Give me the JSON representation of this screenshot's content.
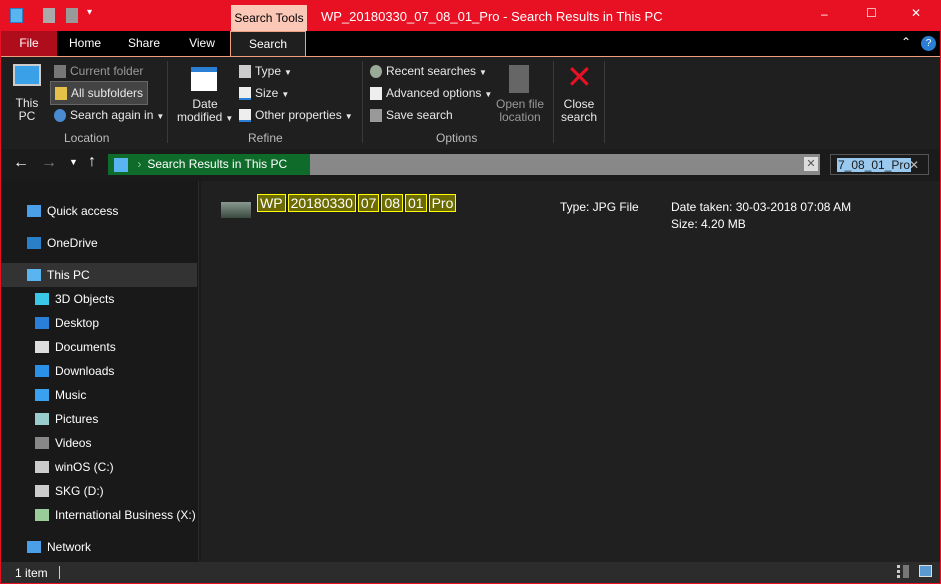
{
  "titlebar": {
    "context_tab": "Search Tools",
    "title": "WP_20180330_07_08_01_Pro - Search Results in This PC",
    "minimize": "–",
    "maximize": "☐",
    "close": "✕"
  },
  "tabs": [
    {
      "label": "File"
    },
    {
      "label": "Home"
    },
    {
      "label": "Share"
    },
    {
      "label": "View"
    },
    {
      "label": "Search"
    }
  ],
  "ribbon": {
    "location": {
      "label": "Location",
      "this_pc": "This PC",
      "current_folder": "Current folder",
      "all_subfolders": "All subfolders",
      "search_again": "Search again in"
    },
    "refine": {
      "label": "Refine",
      "date_modified": "Date modified",
      "type": "Type",
      "size": "Size",
      "other": "Other properties"
    },
    "options": {
      "label": "Options",
      "recent": "Recent searches",
      "advanced": "Advanced options",
      "save": "Save search",
      "open_location": "Open file location"
    },
    "close_search": "Close search"
  },
  "address": {
    "path": "Search Results in This PC",
    "search_value": "7_08_01_Pro"
  },
  "nav": [
    {
      "label": "Quick access",
      "icon": "star"
    },
    {
      "label": "OneDrive",
      "icon": "cloud"
    },
    {
      "label": "This PC",
      "icon": "computer"
    },
    {
      "label": "3D Objects",
      "icon": "cube"
    },
    {
      "label": "Desktop",
      "icon": "desktop"
    },
    {
      "label": "Documents",
      "icon": "document"
    },
    {
      "label": "Downloads",
      "icon": "download"
    },
    {
      "label": "Music",
      "icon": "music"
    },
    {
      "label": "Pictures",
      "icon": "picture"
    },
    {
      "label": "Videos",
      "icon": "film"
    },
    {
      "label": "winOS (C:)",
      "icon": "drive"
    },
    {
      "label": "SKG (D:)",
      "icon": "drive"
    },
    {
      "label": "International Business (X:)",
      "icon": "network-drive"
    },
    {
      "label": "Network",
      "icon": "network"
    }
  ],
  "result": {
    "name_parts": [
      "WP",
      "20180330",
      "07",
      "08",
      "01",
      "Pro"
    ],
    "type": "Type: JPG File",
    "date": "Date taken: 30-03-2018 07:08 AM",
    "size": "Size: 4.20 MB"
  },
  "status": {
    "count": "1 item"
  },
  "colors": {
    "accent": "#e81123",
    "highlight": "#ffff00",
    "address_green": "#0f6b2a"
  }
}
